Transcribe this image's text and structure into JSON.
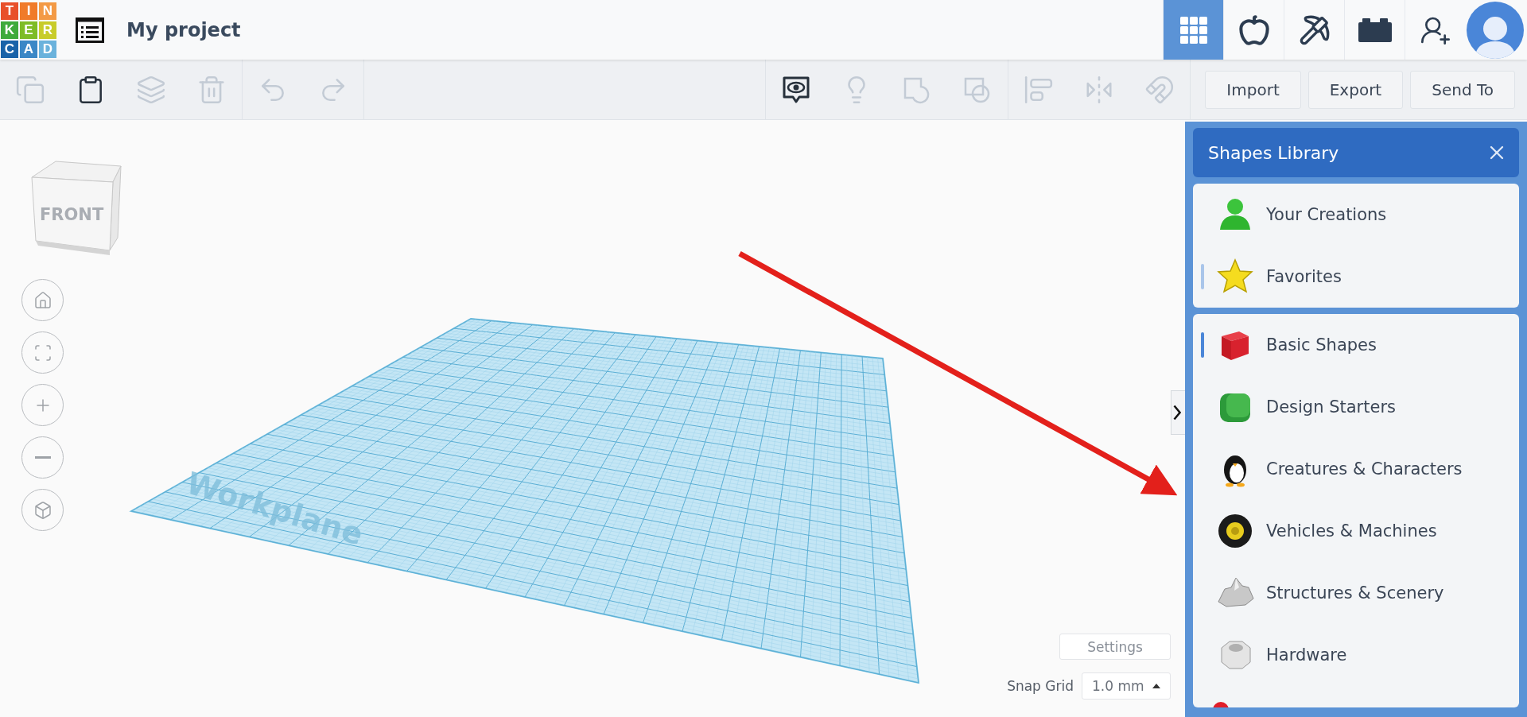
{
  "header": {
    "logo_letters": [
      {
        "char": "T",
        "color": "#e8502a"
      },
      {
        "char": "I",
        "color": "#f07b2a"
      },
      {
        "char": "N",
        "color": "#f39a45"
      },
      {
        "char": "K",
        "color": "#3eaa3c"
      },
      {
        "char": "E",
        "color": "#7ebc27"
      },
      {
        "char": "R",
        "color": "#c8cc2a"
      },
      {
        "char": "C",
        "color": "#1a63a8"
      },
      {
        "char": "A",
        "color": "#3b87c6"
      },
      {
        "char": "D",
        "color": "#6ab2dc"
      }
    ],
    "title": "My project"
  },
  "nav_icons": [
    {
      "kind": "grid",
      "selected": true
    },
    {
      "kind": "circuits",
      "selected": false
    },
    {
      "kind": "pickaxe",
      "selected": false
    },
    {
      "kind": "brick",
      "selected": false
    },
    {
      "kind": "add-user",
      "selected": false
    }
  ],
  "toolbar": {
    "groups": [
      {
        "tools": [
          {
            "kind": "copy",
            "disabled": true
          },
          {
            "kind": "paste",
            "disabled": false
          },
          {
            "kind": "duplicate",
            "disabled": true
          },
          {
            "kind": "delete",
            "disabled": true
          }
        ]
      },
      {
        "tools": [
          {
            "kind": "undo",
            "disabled": true
          },
          {
            "kind": "redo",
            "disabled": true
          }
        ]
      },
      {
        "tools": [
          {
            "kind": "show-all",
            "disabled": false
          },
          {
            "kind": "lightbulb",
            "disabled": true
          },
          {
            "kind": "group",
            "disabled": true
          },
          {
            "kind": "ungroup",
            "disabled": true
          }
        ]
      },
      {
        "tools": [
          {
            "kind": "align",
            "disabled": true
          },
          {
            "kind": "mirror",
            "disabled": true
          },
          {
            "kind": "magnet",
            "disabled": true
          }
        ]
      }
    ],
    "buttons": [
      "Import",
      "Export",
      "Send To"
    ]
  },
  "view_cube": {
    "face": "FRONT"
  },
  "view_controls": [
    {
      "kind": "home"
    },
    {
      "kind": "fit"
    },
    {
      "kind": "zoom-in"
    },
    {
      "kind": "zoom-out"
    },
    {
      "kind": "perspective"
    }
  ],
  "workplane": {
    "label": "Workplane"
  },
  "settings_button": "Settings",
  "snap_grid": {
    "label": "Snap Grid",
    "value": "1.0 mm"
  },
  "shapes_library": {
    "title": "Shapes Library",
    "sections": [
      {
        "items": [
          {
            "kind": "person",
            "label": "Your Creations",
            "selected": false,
            "hovered": false
          },
          {
            "kind": "star",
            "label": "Favorites",
            "selected": false,
            "hovered": true
          }
        ]
      },
      {
        "items": [
          {
            "kind": "cube",
            "label": "Basic Shapes",
            "selected": true,
            "hovered": false
          },
          {
            "kind": "rounded-cube",
            "label": "Design Starters",
            "selected": false,
            "hovered": false
          },
          {
            "kind": "penguin",
            "label": "Creatures & Characters",
            "selected": false,
            "hovered": false
          },
          {
            "kind": "tire",
            "label": "Vehicles & Machines",
            "selected": false,
            "hovered": false
          },
          {
            "kind": "rock",
            "label": "Structures & Scenery",
            "selected": false,
            "hovered": false
          },
          {
            "kind": "nut",
            "label": "Hardware",
            "selected": false,
            "hovered": false
          }
        ]
      }
    ]
  }
}
